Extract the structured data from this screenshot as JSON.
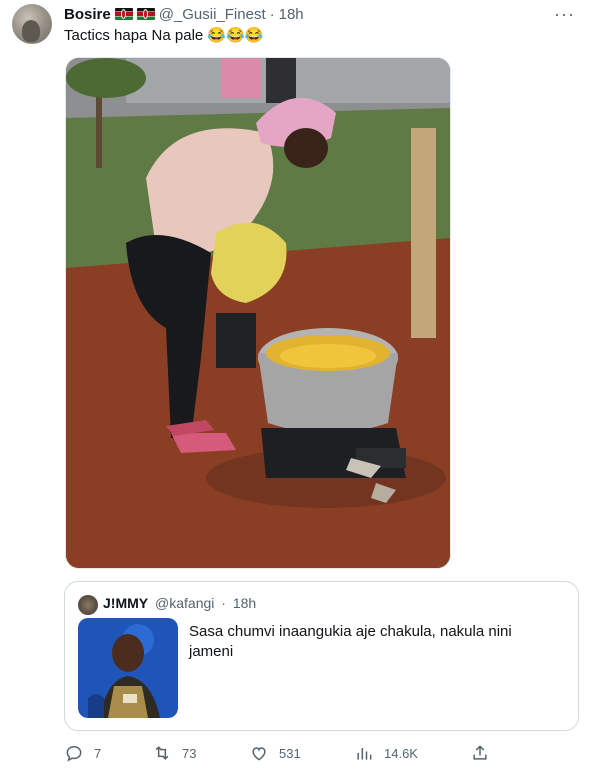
{
  "tweet": {
    "author_name": "Bosire",
    "author_handle": "@_Gusii_Finest",
    "separator": "·",
    "time": "18h",
    "more": "···",
    "text": "Tactics hapa Na pale 😂😂😂"
  },
  "quote": {
    "author_name": "J!MMY",
    "author_handle": "@kafangi",
    "separator": "·",
    "time": "18h",
    "text": "Sasa chumvi inaangukia aje chakula, nakula nini jameni"
  },
  "actions": {
    "replies": "7",
    "retweets": "73",
    "likes": "531",
    "views": "14.6K"
  },
  "icons": {
    "reply": "reply-icon",
    "retweet": "retweet-icon",
    "like": "heart-icon",
    "views": "views-icon",
    "share": "share-icon",
    "flag": "kenya-flag-icon"
  }
}
